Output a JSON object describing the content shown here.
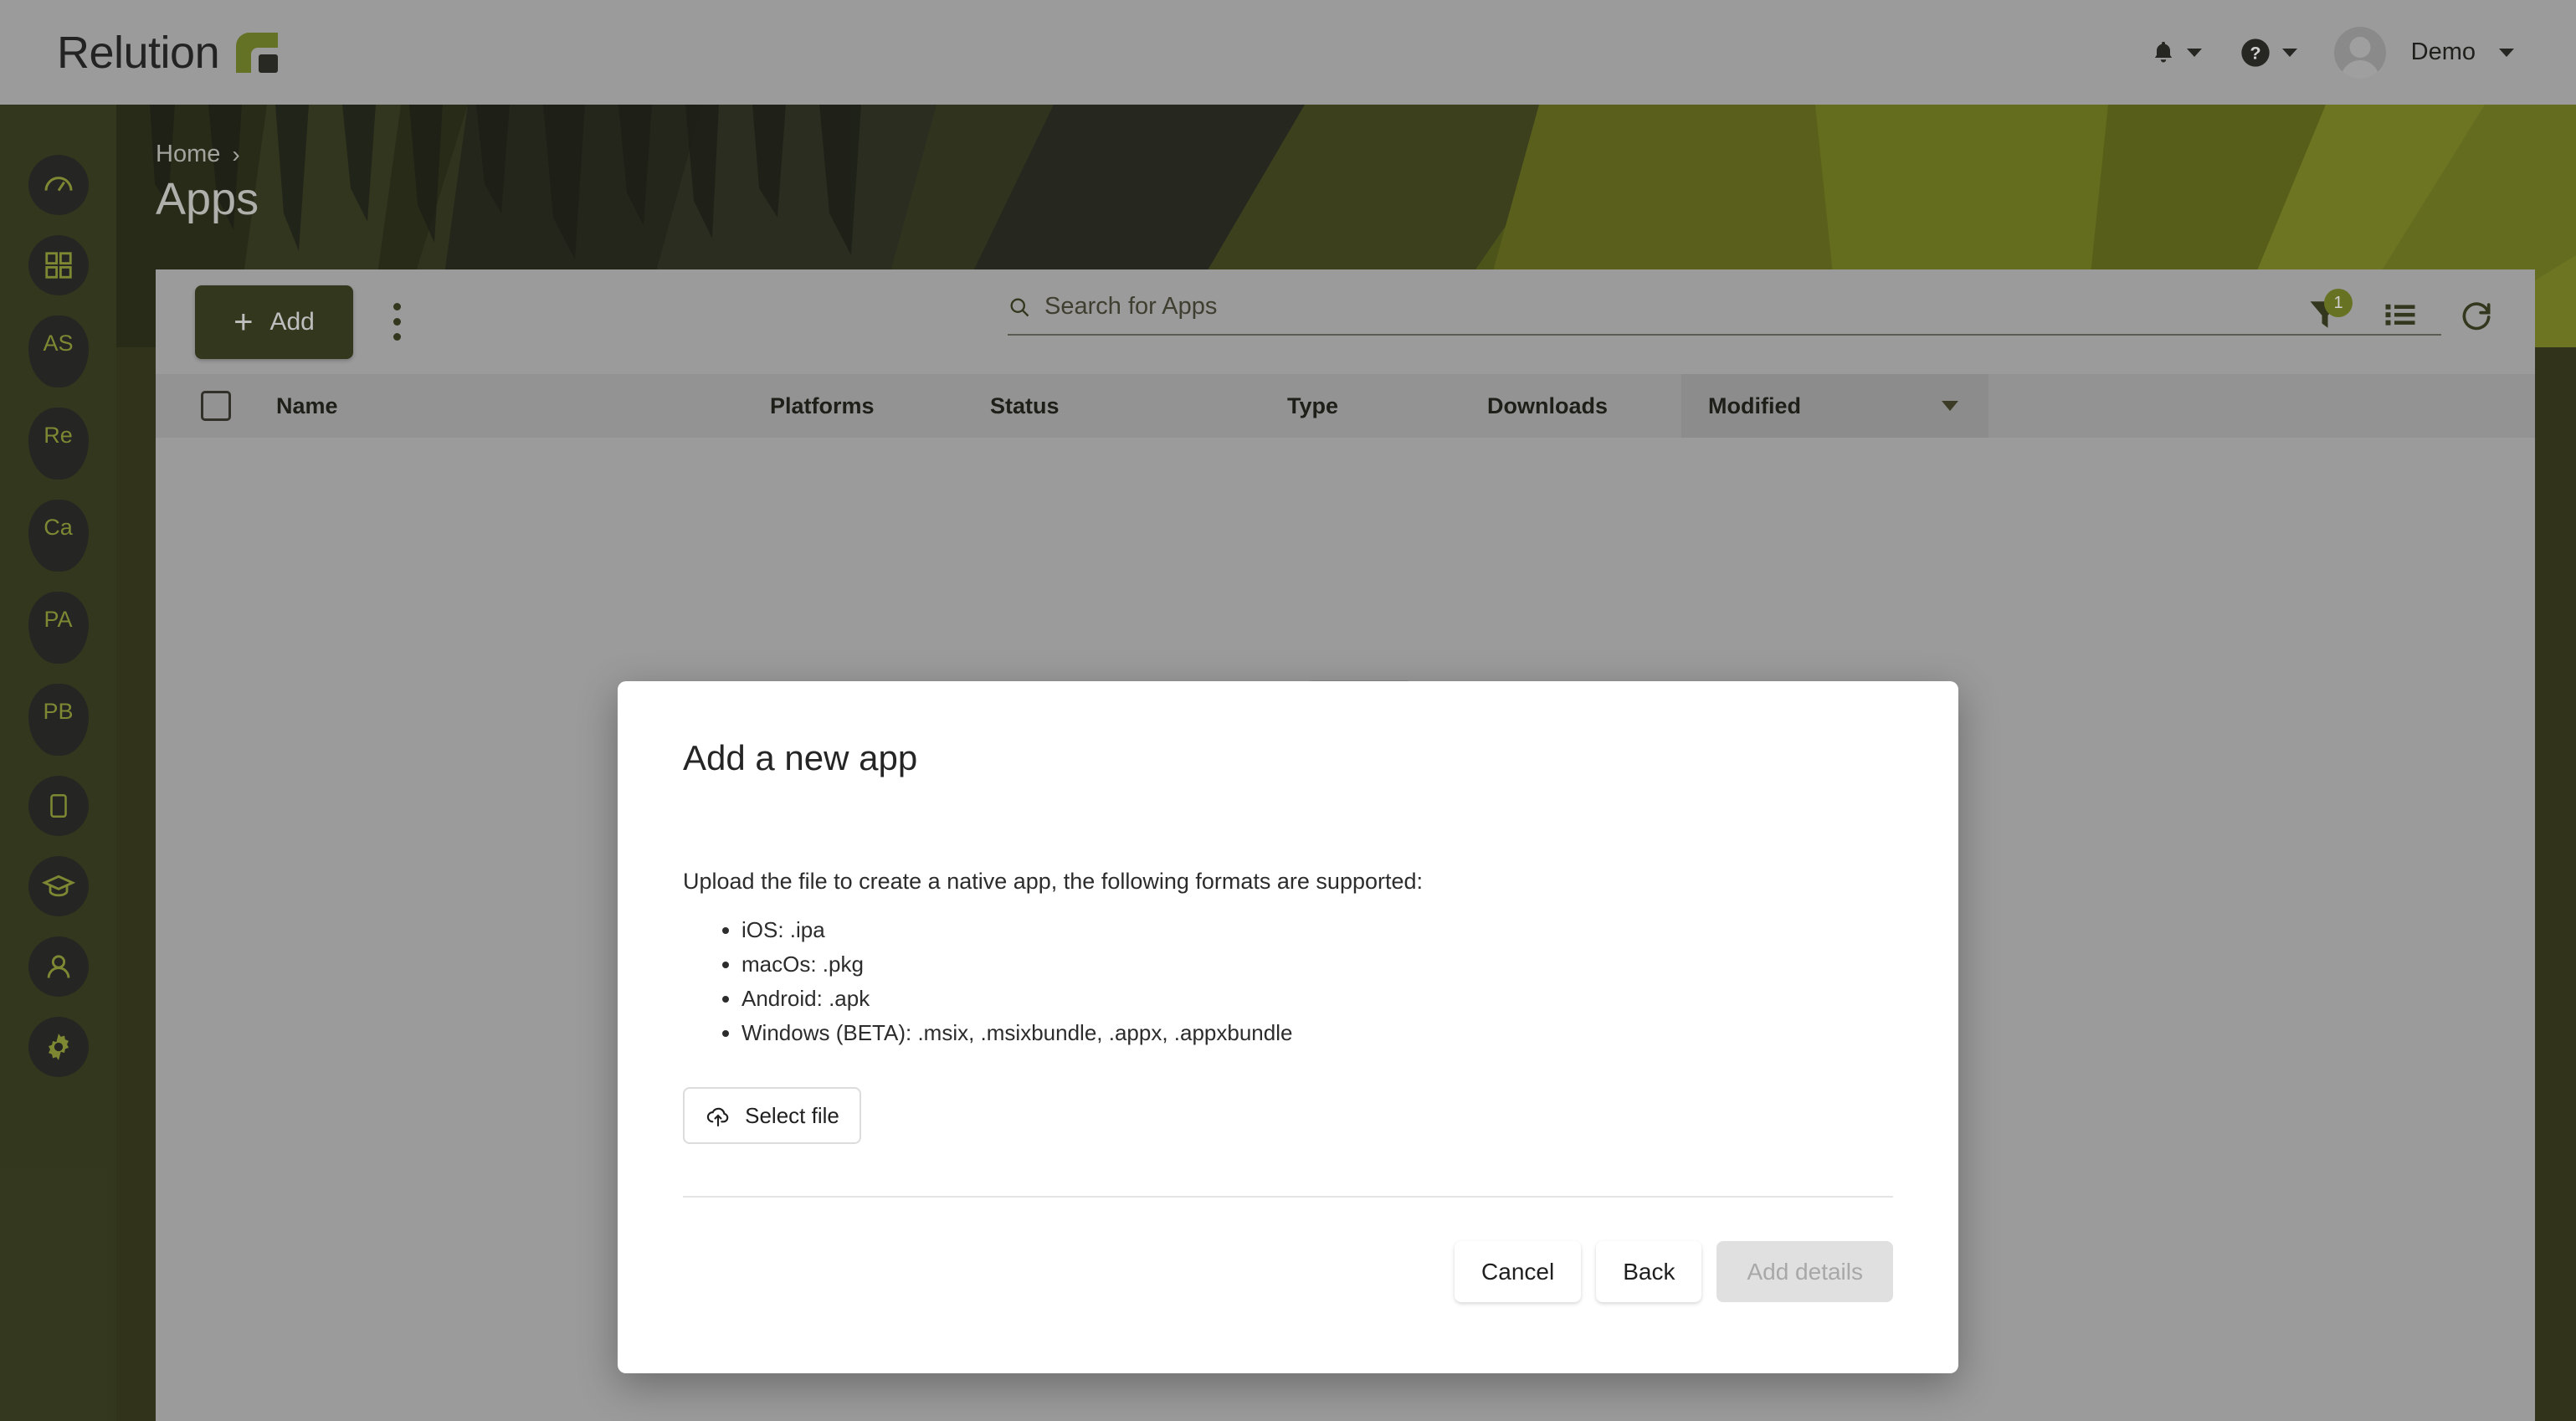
{
  "app": {
    "brand_name": "Relution",
    "accent_green": "#7b8b2e",
    "sidebar_bg": "#3f4424",
    "primary_button_bg": "#3f4424"
  },
  "header": {
    "notifications_icon": "bell-icon",
    "help_icon": "question-circle-icon",
    "user_name": "Demo"
  },
  "sidebar": {
    "items": [
      {
        "name": "dashboard",
        "icon": "gauge-icon",
        "label": ""
      },
      {
        "name": "apps",
        "icon": "grid-icon",
        "label": ""
      },
      {
        "name": "as",
        "icon": "pin-badge",
        "label": "AS"
      },
      {
        "name": "re",
        "icon": "pin-badge",
        "label": "Re"
      },
      {
        "name": "ca",
        "icon": "pin-badge",
        "label": "Ca"
      },
      {
        "name": "pa",
        "icon": "pin-badge",
        "label": "PA"
      },
      {
        "name": "pb",
        "icon": "pin-badge",
        "label": "PB"
      },
      {
        "name": "devices",
        "icon": "device-icon",
        "label": ""
      },
      {
        "name": "education",
        "icon": "graduation-cap-icon",
        "label": ""
      },
      {
        "name": "users",
        "icon": "user-icon",
        "label": ""
      },
      {
        "name": "settings",
        "icon": "gear-icon",
        "label": ""
      }
    ]
  },
  "page": {
    "breadcrumb_home": "Home",
    "breadcrumb_separator": "›",
    "title": "Apps"
  },
  "toolbar": {
    "add_label": "Add",
    "add_plus": "+",
    "overflow_icon": "kebab-menu-icon",
    "filter_icon": "filter-icon",
    "filter_badge": "1",
    "list_view_icon": "list-view-icon",
    "refresh_icon": "refresh-icon"
  },
  "search": {
    "placeholder": "Search for Apps",
    "value": "",
    "icon": "search-icon"
  },
  "table": {
    "columns": [
      "Name",
      "Platforms",
      "Status",
      "Type",
      "Downloads",
      "Modified"
    ],
    "sorted_column": "Modified",
    "sort_direction": "desc",
    "rows": []
  },
  "modal": {
    "title": "Add a new app",
    "intro": "Upload the file to create a native app, the following formats are supported:",
    "formats": [
      "iOS: .ipa",
      "macOs: .pkg",
      "Android: .apk",
      "Windows (BETA): .msix, .msixbundle, .appx, .appxbundle"
    ],
    "select_file_label": "Select file",
    "select_file_icon": "cloud-upload-icon",
    "cancel_label": "Cancel",
    "back_label": "Back",
    "submit_label": "Add details"
  }
}
